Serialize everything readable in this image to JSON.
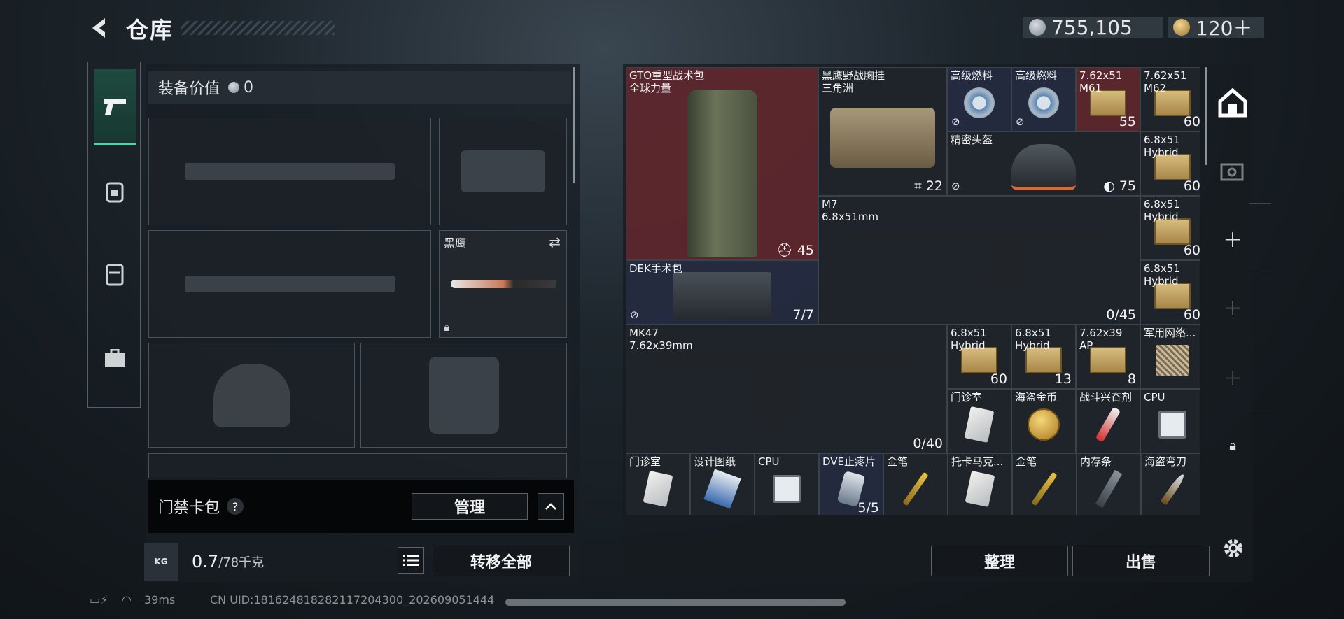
{
  "header": {
    "back_icon": "chevron-left-icon",
    "title": "仓库"
  },
  "currency": {
    "silver": "755,105",
    "gold": "120＋"
  },
  "equipment_value": {
    "label": "装备价值",
    "value": "0"
  },
  "loadout": {
    "knife_name": "黑鹰"
  },
  "card_bag": {
    "label": "门禁卡包",
    "help": "?",
    "manage": "管理",
    "collapse": "^"
  },
  "weight": {
    "icon_label": "KG",
    "value": "0.7",
    "max": "/78千克",
    "transfer_all": "转移全部"
  },
  "stash": {
    "items": [
      {
        "name": "GTO重型战术包",
        "sub": "全球力量",
        "count": "45"
      },
      {
        "name": "黑鹰野战胸挂",
        "sub": "三角洲",
        "count": "22"
      },
      {
        "name": "高级燃料",
        "sub": "",
        "count": ""
      },
      {
        "name": "高级燃料",
        "sub": "",
        "count": ""
      },
      {
        "name": "7.62x51",
        "sub": "M61",
        "count": "55"
      },
      {
        "name": "7.62x51",
        "sub": "M62",
        "count": "60"
      },
      {
        "name": "精密头盔",
        "sub": "",
        "count": "75"
      },
      {
        "name": "6.8x51",
        "sub": "Hybrid",
        "count": "60"
      },
      {
        "name": "M7",
        "sub": "6.8x51mm",
        "count": "0/45"
      },
      {
        "name": "6.8x51",
        "sub": "Hybrid",
        "count": "60"
      },
      {
        "name": "DEK手术包",
        "sub": "",
        "count": "7/7"
      },
      {
        "name": "6.8x51",
        "sub": "Hybrid",
        "count": "60"
      },
      {
        "name": "MK47",
        "sub": "7.62x39mm",
        "count": "0/40"
      },
      {
        "name": "6.8x51",
        "sub": "Hybrid",
        "count": "60"
      },
      {
        "name": "6.8x51",
        "sub": "Hybrid",
        "count": "13"
      },
      {
        "name": "7.62x39",
        "sub": "AP",
        "count": "8"
      },
      {
        "name": "军用网络...",
        "sub": "",
        "count": ""
      },
      {
        "name": "门诊室",
        "sub": "",
        "count": ""
      },
      {
        "name": "海盗金币",
        "sub": "",
        "count": ""
      },
      {
        "name": "战斗兴奋剂",
        "sub": "",
        "count": ""
      },
      {
        "name": "CPU",
        "sub": "",
        "count": ""
      },
      {
        "name": "门诊室",
        "sub": "",
        "count": ""
      },
      {
        "name": "设计图纸",
        "sub": "",
        "count": ""
      },
      {
        "name": "CPU",
        "sub": "",
        "count": ""
      },
      {
        "name": "DVE止疼片",
        "sub": "",
        "count": "5/5"
      },
      {
        "name": "金笔",
        "sub": "",
        "count": ""
      },
      {
        "name": "托卡马克...",
        "sub": "",
        "count": ""
      },
      {
        "name": "金笔",
        "sub": "",
        "count": ""
      },
      {
        "name": "内存条",
        "sub": "",
        "count": ""
      },
      {
        "name": "海盗弯刀",
        "sub": "",
        "count": ""
      }
    ]
  },
  "actions": {
    "sort": "整理",
    "sell": "出售"
  },
  "status": {
    "ping": "39ms",
    "uid": "CN UID:1816248182821172043​00_20260905​1444"
  }
}
